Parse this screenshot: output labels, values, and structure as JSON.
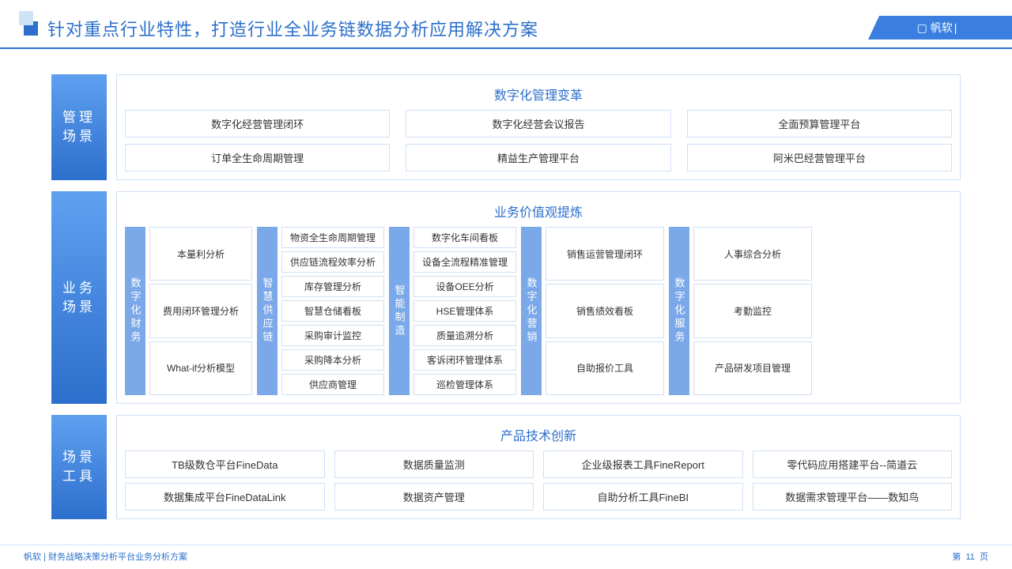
{
  "header": {
    "title": "针对重点行业特性，打造行业全业务链数据分析应用解决方案",
    "brand": "帆软"
  },
  "sections": {
    "manage": {
      "label": "管理\n场景",
      "title": "数字化管理变革",
      "row1": [
        "数字化经营管理闭环",
        "数字化经营会议报告",
        "全面预算管理平台"
      ],
      "row2": [
        "订单全生命周期管理",
        "精益生产管理平台",
        "阿米巴经营管理平台"
      ]
    },
    "biz": {
      "label": "业务\n场景",
      "title": "业务价值观提炼",
      "cols": [
        {
          "label": "数字化财务",
          "items": [
            "本量利分析",
            "费用闭环管理分析",
            "What-if分析模型"
          ]
        },
        {
          "label": "智慧供应链",
          "items": [
            "物资全生命周期管理",
            "供应链流程效率分析",
            "库存管理分析",
            "智慧仓储看板",
            "采购审计监控",
            "采购降本分析",
            "供应商管理"
          ]
        },
        {
          "label": "智能制造",
          "items": [
            "数字化车间看板",
            "设备全流程精准管理",
            "设备OEE分析",
            "HSE管理体系",
            "质量追溯分析",
            "客诉闭环管理体系",
            "巡检管理体系"
          ]
        },
        {
          "label": "数字化营销",
          "items": [
            "销售运营管理闭环",
            "销售绩效看板",
            "自助报价工具"
          ]
        },
        {
          "label": "数字化服务",
          "items": [
            "人事综合分析",
            "考勤监控",
            "产品研发项目管理"
          ]
        }
      ]
    },
    "tools": {
      "label": "场景\n工具",
      "title": "产品技术创新",
      "row1": [
        "TB级数仓平台FineData",
        "数据质量监测",
        "企业级报表工具FineReport",
        "零代码应用搭建平台--简道云"
      ],
      "row2": [
        "数据集成平台FineDataLink",
        "数据资产管理",
        "自助分析工具FineBI",
        "数据需求管理平台——数知鸟"
      ]
    }
  },
  "footer": {
    "left": "帆软 | 财务战略决策分析平台业务分析方案",
    "page": "11",
    "p1": "第",
    "p2": "页"
  }
}
